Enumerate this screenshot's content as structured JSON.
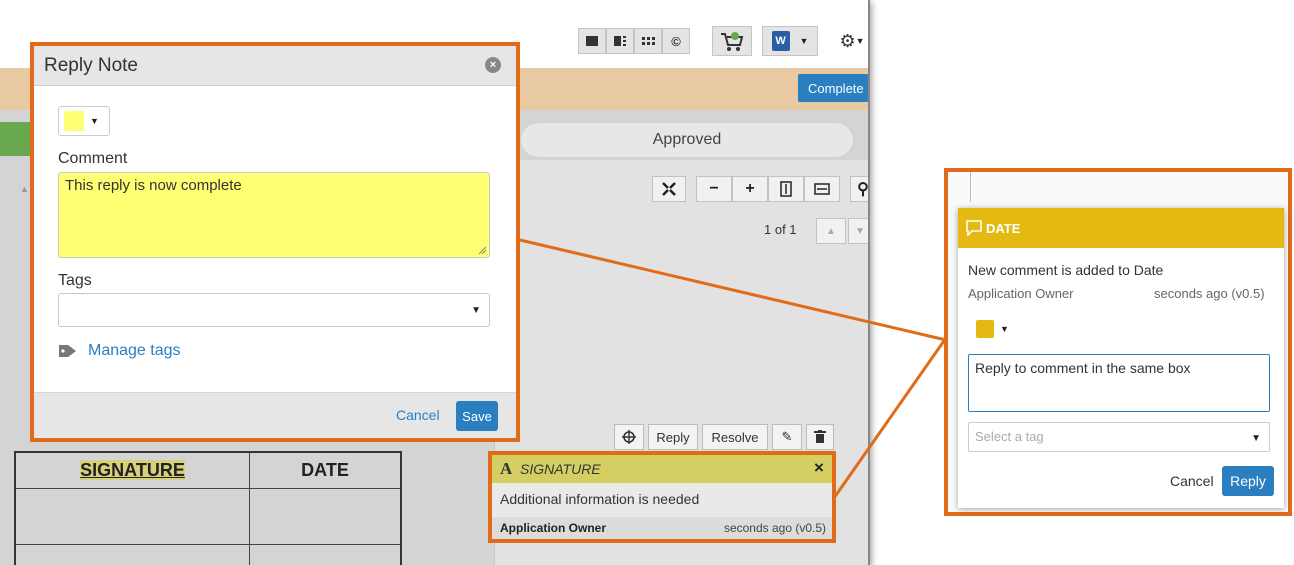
{
  "colors": {
    "accent_orange": "#e06b18",
    "primary_blue": "#2a7fc1",
    "note_yellow": "#ffff73",
    "date_header": "#e3b912",
    "signature_header": "#d5cf63",
    "approved_green": "#6aa84f"
  },
  "toolbar": {
    "icons": [
      "single-page-view-icon",
      "side-by-side-view-icon",
      "grid-view-icon",
      "copyright-icon",
      "cart-icon",
      "word-export-icon",
      "settings-icon"
    ],
    "complete_label": "Complete"
  },
  "status": {
    "approved_label": "Approved"
  },
  "viewer": {
    "page_counter": "1 of 1",
    "controls": [
      "fullscreen-icon",
      "zoom-out-icon",
      "zoom-in-icon",
      "fit-height-icon",
      "fit-width-icon"
    ]
  },
  "reply_dialog": {
    "title": "Reply Note",
    "color_value": "#ffff73",
    "comment_label": "Comment",
    "comment_value": "This reply is now complete",
    "tags_label": "Tags",
    "tags_value": "",
    "manage_tags_label": "Manage tags",
    "cancel_label": "Cancel",
    "save_label": "Save"
  },
  "document": {
    "col1_header": "SIGNATURE",
    "col2_header": "DATE"
  },
  "annotation_actions": {
    "reply_label": "Reply",
    "resolve_label": "Resolve"
  },
  "signature_note": {
    "type_glyph": "A",
    "title": "SIGNATURE",
    "close_glyph": "×",
    "message": "Additional information is needed",
    "author": "Application Owner",
    "time": "seconds ago (v0.5)"
  },
  "date_panel": {
    "title": "DATE",
    "message": "New comment is added to Date",
    "author": "Application Owner",
    "time": "seconds ago (v0.5)",
    "color_value": "#e3b912",
    "reply_value": "Reply to comment in the same box",
    "tag_placeholder": "Select a tag",
    "cancel_label": "Cancel",
    "reply_label": "Reply"
  }
}
